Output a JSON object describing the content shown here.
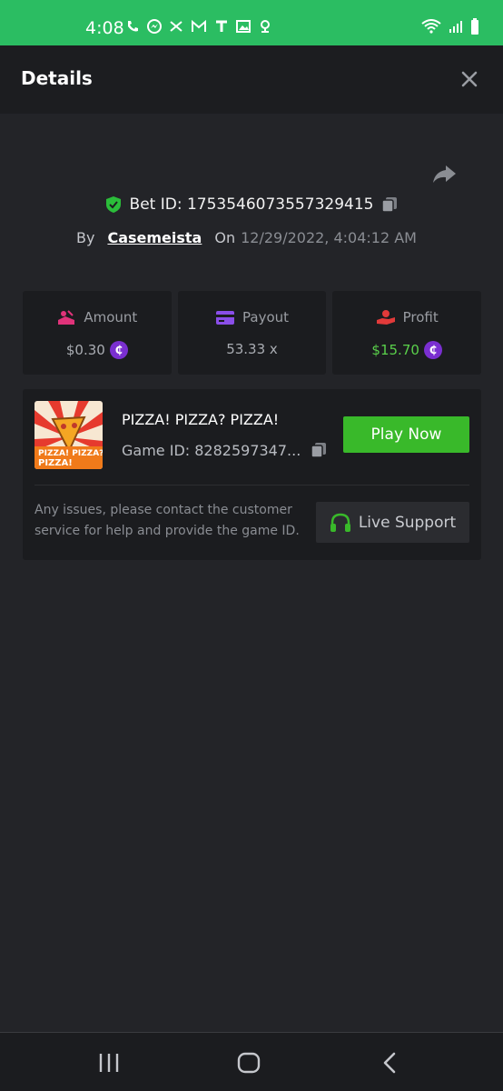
{
  "status_bar": {
    "time": "4:08"
  },
  "header": {
    "title": "Details"
  },
  "bet": {
    "id_label": "Bet ID: 1753546073557329415",
    "by_label": "By",
    "username": "Casemeista",
    "on_label": "On",
    "date": "12/29/2022, 4:04:12 AM"
  },
  "stats": {
    "amount": {
      "label": "Amount",
      "value": "$0.30"
    },
    "payout": {
      "label": "Payout",
      "value": "53.33 x"
    },
    "profit": {
      "label": "Profit",
      "value": "$15.70"
    }
  },
  "game": {
    "title": "PIZZA! PIZZA? PIZZA!",
    "id_label": "Game ID: 8282597347...",
    "thumb_text": "PIZZA! PIZZA? PIZZA!",
    "play_label": "Play Now"
  },
  "support": {
    "help_text": "Any issues, please contact the customer service for help and provide the game ID.",
    "button_label": "Live Support"
  },
  "colors": {
    "status_bar": "#2bbd62",
    "accent_green": "#39b92a",
    "coin": "#7a2fd0",
    "profit_green": "#5ad04b"
  },
  "icons": {
    "coin_glyph": "₵"
  }
}
